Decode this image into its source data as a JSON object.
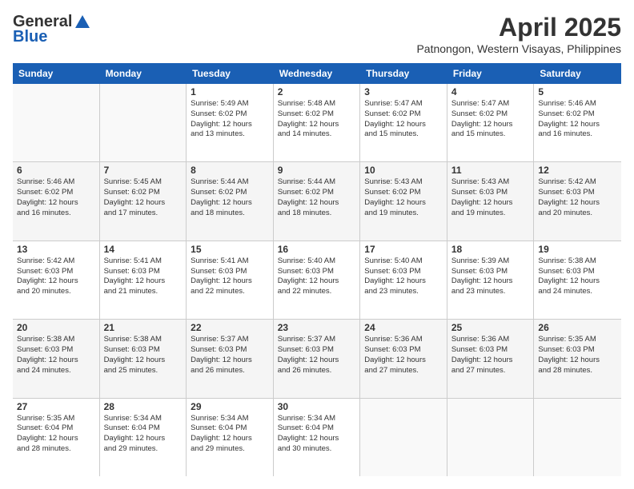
{
  "header": {
    "logo": {
      "general": "General",
      "blue": "Blue"
    },
    "title": "April 2025",
    "subtitle": "Patnongon, Western Visayas, Philippines"
  },
  "days_of_week": [
    "Sunday",
    "Monday",
    "Tuesday",
    "Wednesday",
    "Thursday",
    "Friday",
    "Saturday"
  ],
  "weeks": [
    [
      {
        "day": "",
        "info": ""
      },
      {
        "day": "",
        "info": ""
      },
      {
        "day": "1",
        "info": "Sunrise: 5:49 AM\nSunset: 6:02 PM\nDaylight: 12 hours\nand 13 minutes."
      },
      {
        "day": "2",
        "info": "Sunrise: 5:48 AM\nSunset: 6:02 PM\nDaylight: 12 hours\nand 14 minutes."
      },
      {
        "day": "3",
        "info": "Sunrise: 5:47 AM\nSunset: 6:02 PM\nDaylight: 12 hours\nand 15 minutes."
      },
      {
        "day": "4",
        "info": "Sunrise: 5:47 AM\nSunset: 6:02 PM\nDaylight: 12 hours\nand 15 minutes."
      },
      {
        "day": "5",
        "info": "Sunrise: 5:46 AM\nSunset: 6:02 PM\nDaylight: 12 hours\nand 16 minutes."
      }
    ],
    [
      {
        "day": "6",
        "info": "Sunrise: 5:46 AM\nSunset: 6:02 PM\nDaylight: 12 hours\nand 16 minutes."
      },
      {
        "day": "7",
        "info": "Sunrise: 5:45 AM\nSunset: 6:02 PM\nDaylight: 12 hours\nand 17 minutes."
      },
      {
        "day": "8",
        "info": "Sunrise: 5:44 AM\nSunset: 6:02 PM\nDaylight: 12 hours\nand 18 minutes."
      },
      {
        "day": "9",
        "info": "Sunrise: 5:44 AM\nSunset: 6:02 PM\nDaylight: 12 hours\nand 18 minutes."
      },
      {
        "day": "10",
        "info": "Sunrise: 5:43 AM\nSunset: 6:02 PM\nDaylight: 12 hours\nand 19 minutes."
      },
      {
        "day": "11",
        "info": "Sunrise: 5:43 AM\nSunset: 6:03 PM\nDaylight: 12 hours\nand 19 minutes."
      },
      {
        "day": "12",
        "info": "Sunrise: 5:42 AM\nSunset: 6:03 PM\nDaylight: 12 hours\nand 20 minutes."
      }
    ],
    [
      {
        "day": "13",
        "info": "Sunrise: 5:42 AM\nSunset: 6:03 PM\nDaylight: 12 hours\nand 20 minutes."
      },
      {
        "day": "14",
        "info": "Sunrise: 5:41 AM\nSunset: 6:03 PM\nDaylight: 12 hours\nand 21 minutes."
      },
      {
        "day": "15",
        "info": "Sunrise: 5:41 AM\nSunset: 6:03 PM\nDaylight: 12 hours\nand 22 minutes."
      },
      {
        "day": "16",
        "info": "Sunrise: 5:40 AM\nSunset: 6:03 PM\nDaylight: 12 hours\nand 22 minutes."
      },
      {
        "day": "17",
        "info": "Sunrise: 5:40 AM\nSunset: 6:03 PM\nDaylight: 12 hours\nand 23 minutes."
      },
      {
        "day": "18",
        "info": "Sunrise: 5:39 AM\nSunset: 6:03 PM\nDaylight: 12 hours\nand 23 minutes."
      },
      {
        "day": "19",
        "info": "Sunrise: 5:38 AM\nSunset: 6:03 PM\nDaylight: 12 hours\nand 24 minutes."
      }
    ],
    [
      {
        "day": "20",
        "info": "Sunrise: 5:38 AM\nSunset: 6:03 PM\nDaylight: 12 hours\nand 24 minutes."
      },
      {
        "day": "21",
        "info": "Sunrise: 5:38 AM\nSunset: 6:03 PM\nDaylight: 12 hours\nand 25 minutes."
      },
      {
        "day": "22",
        "info": "Sunrise: 5:37 AM\nSunset: 6:03 PM\nDaylight: 12 hours\nand 26 minutes."
      },
      {
        "day": "23",
        "info": "Sunrise: 5:37 AM\nSunset: 6:03 PM\nDaylight: 12 hours\nand 26 minutes."
      },
      {
        "day": "24",
        "info": "Sunrise: 5:36 AM\nSunset: 6:03 PM\nDaylight: 12 hours\nand 27 minutes."
      },
      {
        "day": "25",
        "info": "Sunrise: 5:36 AM\nSunset: 6:03 PM\nDaylight: 12 hours\nand 27 minutes."
      },
      {
        "day": "26",
        "info": "Sunrise: 5:35 AM\nSunset: 6:03 PM\nDaylight: 12 hours\nand 28 minutes."
      }
    ],
    [
      {
        "day": "27",
        "info": "Sunrise: 5:35 AM\nSunset: 6:04 PM\nDaylight: 12 hours\nand 28 minutes."
      },
      {
        "day": "28",
        "info": "Sunrise: 5:34 AM\nSunset: 6:04 PM\nDaylight: 12 hours\nand 29 minutes."
      },
      {
        "day": "29",
        "info": "Sunrise: 5:34 AM\nSunset: 6:04 PM\nDaylight: 12 hours\nand 29 minutes."
      },
      {
        "day": "30",
        "info": "Sunrise: 5:34 AM\nSunset: 6:04 PM\nDaylight: 12 hours\nand 30 minutes."
      },
      {
        "day": "",
        "info": ""
      },
      {
        "day": "",
        "info": ""
      },
      {
        "day": "",
        "info": ""
      }
    ]
  ]
}
